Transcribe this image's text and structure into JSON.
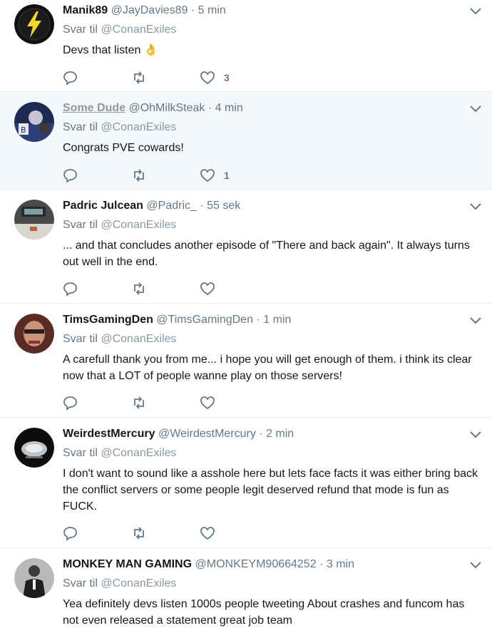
{
  "reply_prefix": "Svar til",
  "tweets": [
    {
      "name": "Manik89",
      "handle": "@JayDavies89",
      "time": "5 min",
      "reply_to": "@ConanExiles",
      "text": "Devs that listen 👌",
      "replies": "",
      "retweets": "",
      "likes": "3",
      "avatar": "lightning-bolt-avatar"
    },
    {
      "name": "Some Dude",
      "handle": "@OhMilkSteak",
      "time": "4 min",
      "reply_to": "@ConanExiles",
      "text": "Congrats PVE cowards!",
      "replies": "",
      "retweets": "",
      "likes": "1",
      "avatar": "character-avatar"
    },
    {
      "name": "Padric Julcean",
      "handle": "@Padric_",
      "time": "55 sek",
      "reply_to": "@ConanExiles",
      "text": "... and that concludes another episode of \"There and back again\". It always turns out well in the end.",
      "replies": "",
      "retweets": "",
      "likes": "",
      "avatar": "desk-avatar"
    },
    {
      "name": "TimsGamingDen",
      "handle": "@TimsGamingDen",
      "time": "1 min",
      "reply_to": "@ConanExiles",
      "text": "A carefull thank you from me... i hope you will get enough of them. i think its clear now that a LOT of people wanne play on those servers!",
      "replies": "",
      "retweets": "",
      "likes": "",
      "avatar": "face-avatar"
    },
    {
      "name": "WeirdestMercury",
      "handle": "@WeirdestMercury",
      "time": "2 min",
      "reply_to": "@ConanExiles",
      "text": "I don't want to sound like a asshole here but lets face facts it was either bring back the conflict servers or some people legit deserved refund that mode is fun as FUCK.",
      "replies": "",
      "retweets": "",
      "likes": "",
      "avatar": "metal-logo-avatar"
    },
    {
      "name": "MONKEY MAN GAMING",
      "handle": "@MONKEYM90664252",
      "time": "3 min",
      "reply_to": "@ConanExiles",
      "text": "Yea definitely devs listen 1000s people tweeting About crashes and funcom has not even released a statement great job team",
      "replies": "",
      "retweets": "",
      "likes": "",
      "avatar": "suit-figure-avatar"
    }
  ]
}
